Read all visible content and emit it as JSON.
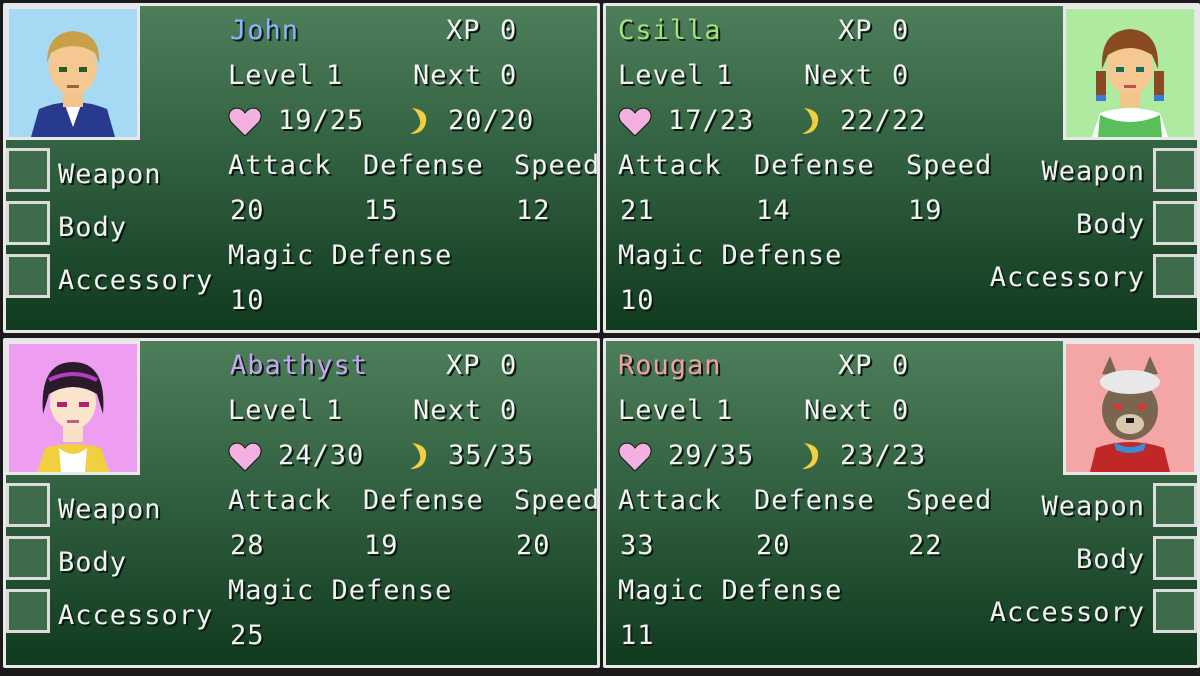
{
  "party": [
    {
      "name": "John",
      "name_color": "#8fb4ff",
      "xp_label": "XP",
      "xp": "0",
      "level_label": "Level",
      "level": "1",
      "next_label": "Next",
      "next": "0",
      "hp": "19/25",
      "mp": "20/20",
      "attack_label": "Attack",
      "attack": "20",
      "defense_label": "Defense",
      "defense": "15",
      "speed_label": "Speed",
      "speed": "12",
      "mdef_label": "Magic Defense",
      "mdef": "10",
      "slots": [
        "Weapon",
        "Body",
        "Accessory"
      ],
      "portrait_bg": "#a6daf4"
    },
    {
      "name": "Csilla",
      "name_color": "#a6e07a",
      "xp_label": "XP",
      "xp": "0",
      "level_label": "Level",
      "level": "1",
      "next_label": "Next",
      "next": "0",
      "hp": "17/23",
      "mp": "22/22",
      "attack_label": "Attack",
      "attack": "21",
      "defense_label": "Defense",
      "defense": "14",
      "speed_label": "Speed",
      "speed": "19",
      "mdef_label": "Magic Defense",
      "mdef": "10",
      "slots": [
        "Weapon",
        "Body",
        "Accessory"
      ],
      "portrait_bg": "#aeeaa0"
    },
    {
      "name": "Abathyst",
      "name_color": "#c6a6f0",
      "xp_label": "XP",
      "xp": "0",
      "level_label": "Level",
      "level": "1",
      "next_label": "Next",
      "next": "0",
      "hp": "24/30",
      "mp": "35/35",
      "attack_label": "Attack",
      "attack": "28",
      "defense_label": "Defense",
      "defense": "19",
      "speed_label": "Speed",
      "speed": "20",
      "mdef_label": "Magic Defense",
      "mdef": "25",
      "slots": [
        "Weapon",
        "Body",
        "Accessory"
      ],
      "portrait_bg": "#ee9ef0"
    },
    {
      "name": "Rougan",
      "name_color": "#f0a0a0",
      "xp_label": "XP",
      "xp": "0",
      "level_label": "Level",
      "level": "1",
      "next_label": "Next",
      "next": "0",
      "hp": "29/35",
      "mp": "23/23",
      "attack_label": "Attack",
      "attack": "33",
      "defense_label": "Defense",
      "defense": "20",
      "speed_label": "Speed",
      "speed": "22",
      "mdef_label": "Magic Defense",
      "mdef": "11",
      "slots": [
        "Weapon",
        "Body",
        "Accessory"
      ],
      "portrait_bg": "#f4a6a6"
    }
  ],
  "icons": {
    "hp": "heart-icon",
    "mp": "crescent-moon-icon"
  },
  "colors": {
    "heart": "#f4b0e0",
    "moon": "#f0d040",
    "panel_top": "#4d7e5a",
    "panel_bottom": "#103a1e"
  }
}
